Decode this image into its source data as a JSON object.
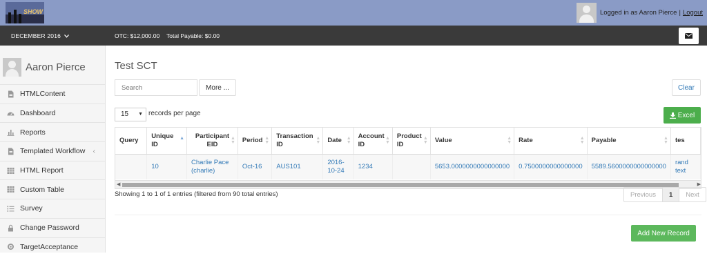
{
  "topbar": {
    "logo_text": "SHOW",
    "user_text": "Logged in as Aaron Pierce",
    "separator": "|",
    "logout": "Logout"
  },
  "status": {
    "period": "DECEMBER 2016",
    "otc": "OTC: $12,000.00",
    "payable": "Total Payable: $0.00"
  },
  "sidebar": {
    "user_name": "Aaron Pierce",
    "items": [
      {
        "label": "HTMLContent",
        "icon": "document-icon"
      },
      {
        "label": "Dashboard",
        "icon": "dashboard-icon"
      },
      {
        "label": "Reports",
        "icon": "bar-chart-icon"
      },
      {
        "label": "Templated Workflow",
        "icon": "document-icon"
      },
      {
        "label": "HTML Report",
        "icon": "table-icon"
      },
      {
        "label": "Custom Table",
        "icon": "table-icon"
      },
      {
        "label": "Survey",
        "icon": "list-icon"
      },
      {
        "label": "Change Password",
        "icon": "lock-icon"
      },
      {
        "label": "TargetAcceptance",
        "icon": "target-icon"
      }
    ]
  },
  "main": {
    "title": "Test SCT",
    "search_placeholder": "Search",
    "more_button": "More ...",
    "clear_button": "Clear",
    "page_length": "15",
    "page_length_label": "records per page",
    "excel_button": "Excel",
    "columns": [
      "Query",
      "Unique ID",
      "Participant EID",
      "Period",
      "Transaction ID",
      "Date",
      "Account ID",
      "Product ID",
      "Value",
      "Rate",
      "Payable",
      "tes"
    ],
    "rows": [
      [
        "",
        "10",
        "Charlie Pace (charlie)",
        "Oct-16",
        "AUS101",
        "2016-10-24",
        "1234",
        "",
        "5653.0000000000000000",
        "0.7500000000000000",
        "5589.5600000000000000",
        "rand text"
      ]
    ],
    "info": "Showing 1 to 1 of 1 entries (filtered from 90 total entries)",
    "pager": {
      "previous": "Previous",
      "current": "1",
      "next": "Next"
    },
    "add_button": "Add New Record"
  },
  "colors": {
    "topbar": "#8a9bc6",
    "statusbar": "#3a3a3a",
    "link": "#337ab7",
    "success": "#5cb85c"
  }
}
